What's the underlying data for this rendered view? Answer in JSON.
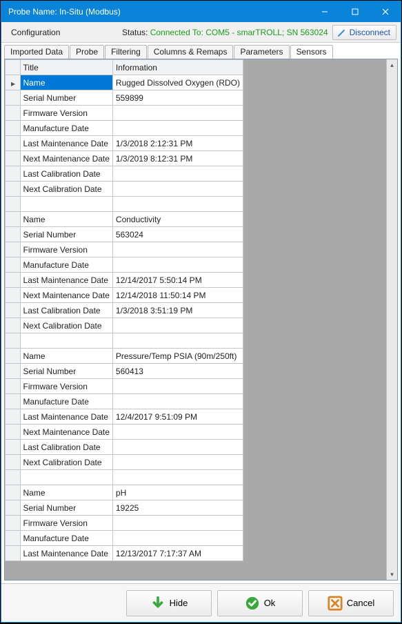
{
  "window": {
    "title": "Probe Name: In-Situ (Modbus)"
  },
  "header": {
    "config_label": "Configuration",
    "status_prefix": "Status:  ",
    "status_value": "Connected To: COM5 - smarTROLL; SN 563024",
    "disconnect_label": "Disconnect"
  },
  "tabs": {
    "items": [
      "Imported Data",
      "Probe",
      "Filtering",
      "Columns & Remaps",
      "Parameters",
      "Sensors"
    ],
    "active_index": 5
  },
  "grid": {
    "columns": {
      "title": "Title",
      "info": "Information"
    },
    "rows": [
      {
        "title": "Name",
        "info": "Rugged Dissolved Oxygen (RDO)",
        "selected": true
      },
      {
        "title": "Serial Number",
        "info": "559899"
      },
      {
        "title": "Firmware Version",
        "info": ""
      },
      {
        "title": "Manufacture Date",
        "info": ""
      },
      {
        "title": "Last Maintenance Date",
        "info": "1/3/2018 2:12:31 PM"
      },
      {
        "title": "Next Maintenance Date",
        "info": "1/3/2019 8:12:31 PM"
      },
      {
        "title": "Last Calibration Date",
        "info": ""
      },
      {
        "title": "Next Calibration Date",
        "info": ""
      },
      {
        "title": "",
        "info": ""
      },
      {
        "title": "Name",
        "info": "Conductivity"
      },
      {
        "title": "Serial Number",
        "info": "563024"
      },
      {
        "title": "Firmware Version",
        "info": ""
      },
      {
        "title": "Manufacture Date",
        "info": ""
      },
      {
        "title": "Last Maintenance Date",
        "info": "12/14/2017 5:50:14 PM"
      },
      {
        "title": "Next Maintenance Date",
        "info": "12/14/2018 11:50:14 PM"
      },
      {
        "title": "Last Calibration Date",
        "info": "1/3/2018 3:51:19 PM"
      },
      {
        "title": "Next Calibration Date",
        "info": ""
      },
      {
        "title": "",
        "info": ""
      },
      {
        "title": "Name",
        "info": "Pressure/Temp PSIA (90m/250ft)"
      },
      {
        "title": "Serial Number",
        "info": "560413"
      },
      {
        "title": "Firmware Version",
        "info": ""
      },
      {
        "title": "Manufacture Date",
        "info": ""
      },
      {
        "title": "Last Maintenance Date",
        "info": "12/4/2017 9:51:09 PM"
      },
      {
        "title": "Next Maintenance Date",
        "info": ""
      },
      {
        "title": "Last Calibration Date",
        "info": ""
      },
      {
        "title": "Next Calibration Date",
        "info": ""
      },
      {
        "title": "",
        "info": ""
      },
      {
        "title": "Name",
        "info": "pH"
      },
      {
        "title": "Serial Number",
        "info": "19225"
      },
      {
        "title": "Firmware Version",
        "info": ""
      },
      {
        "title": "Manufacture Date",
        "info": ""
      },
      {
        "title": "Last Maintenance Date",
        "info": "12/13/2017 7:17:37 AM"
      }
    ]
  },
  "buttons": {
    "hide": "Hide",
    "ok": "Ok",
    "cancel": "Cancel"
  }
}
